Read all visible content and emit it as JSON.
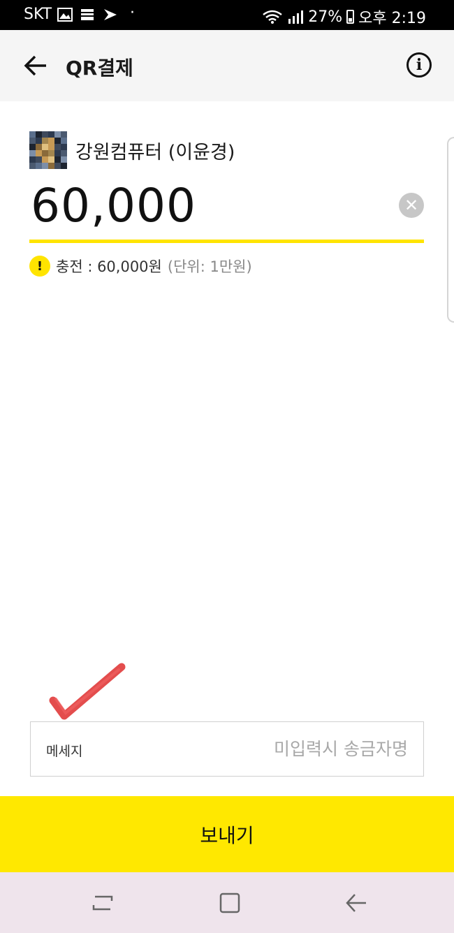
{
  "status_bar": {
    "carrier": "SKT",
    "dot": "·",
    "battery": "27%",
    "time": "오후 2:19",
    "icons": [
      "image-icon",
      "spreadsheet-icon",
      "app-notification-icon",
      "wifi-icon",
      "signal-icon",
      "battery-icon"
    ]
  },
  "app_bar": {
    "title": "QR결제",
    "back_icon": "arrow-left-icon",
    "info_icon": "info-icon",
    "info_glyph": "i"
  },
  "recipient": {
    "name": "강원컴퓨터 (이윤경)"
  },
  "amount": {
    "value": "60,000",
    "clear_glyph": "✕"
  },
  "notice": {
    "warn_glyph": "!",
    "text": "충전 : 60,000원",
    "unit": "(단위: 1만원)"
  },
  "message": {
    "label": "메세지",
    "placeholder": "미입력시 송금자명",
    "value": ""
  },
  "send_button": {
    "label": "보내기"
  },
  "colors": {
    "accent_yellow": "#ffe800",
    "underline_yellow": "#ffe400",
    "app_bar_bg": "#f5f5f5",
    "nav_bar_bg": "#efe4ec",
    "check_mark_red": "#e03a3a"
  },
  "nav_bar": {
    "icons": [
      "recent-apps-icon",
      "home-icon",
      "back-icon"
    ]
  }
}
